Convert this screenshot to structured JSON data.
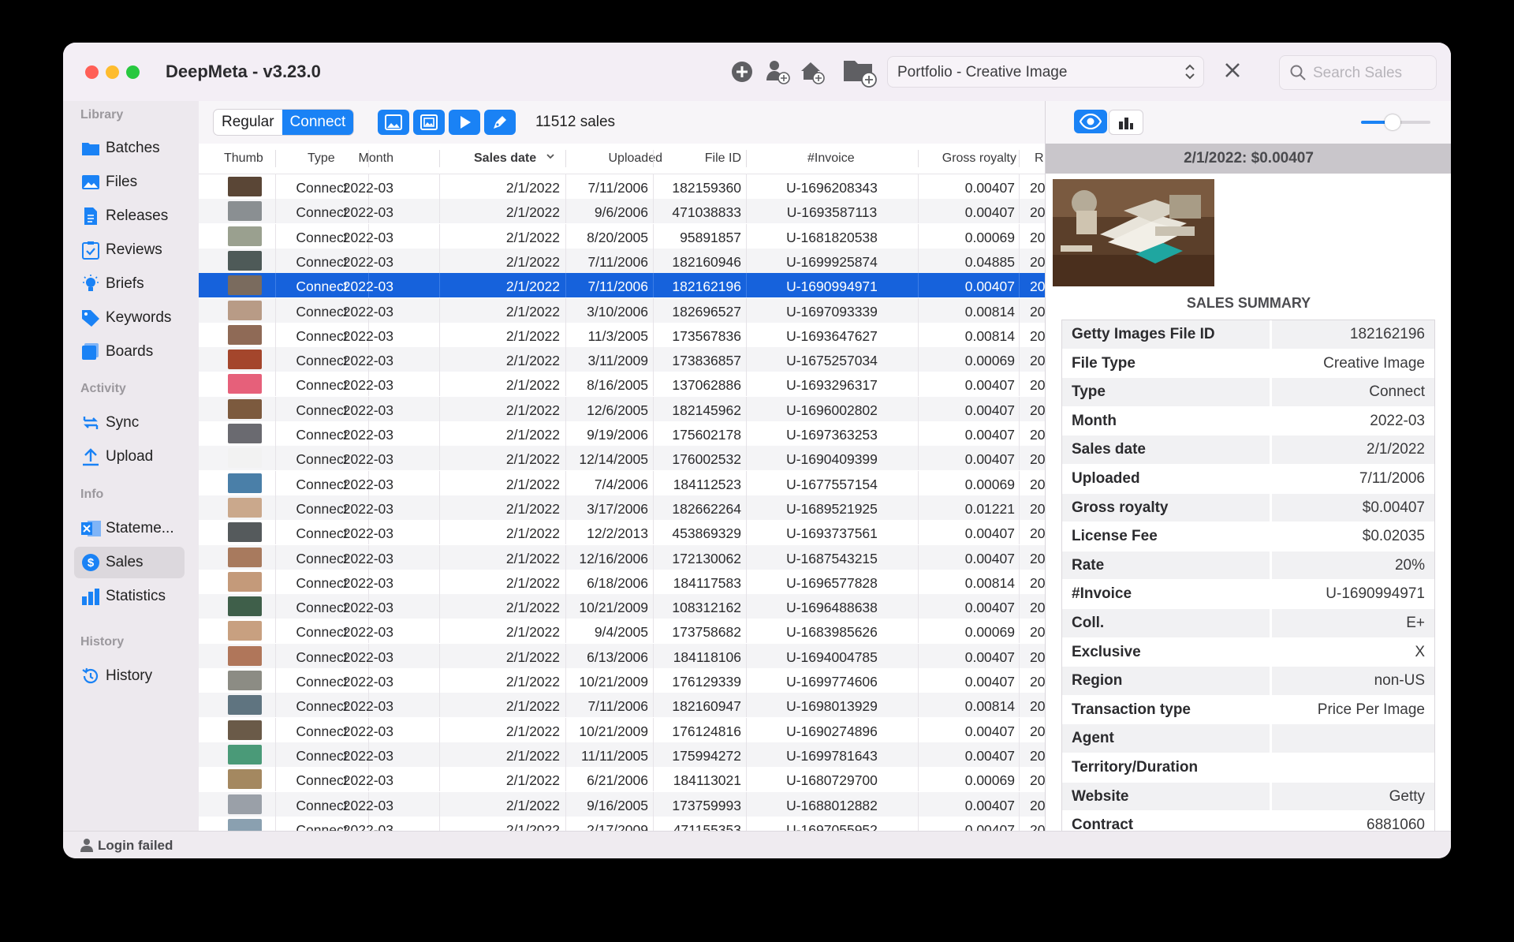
{
  "app": {
    "title": "DeepMeta - v3.23.0"
  },
  "toolbar": {
    "portfolio": "Portfolio - Creative Image",
    "search_placeholder": "Search Sales",
    "mode_regular": "Regular",
    "mode_connect": "Connect",
    "sales_count": "11512 sales"
  },
  "sidebar": {
    "sections": [
      {
        "label": "Library",
        "items": [
          "Batches",
          "Files",
          "Releases",
          "Reviews",
          "Briefs",
          "Keywords",
          "Boards"
        ]
      },
      {
        "label": "Activity",
        "items": [
          "Sync",
          "Upload"
        ]
      },
      {
        "label": "Info",
        "items": [
          "Stateme...",
          "Sales",
          "Statistics"
        ]
      },
      {
        "label": "History",
        "items": [
          "History"
        ]
      }
    ],
    "active": "Sales"
  },
  "table": {
    "columns": [
      "Thumb",
      "Type",
      "Month",
      "Sales date",
      "Uploaded",
      "File ID",
      "#Invoice",
      "Gross royalty",
      "R"
    ],
    "rows": [
      [
        "Connect",
        "2022-03",
        "2/1/2022",
        "7/11/2006",
        "182159360",
        "U-1696208343",
        "0.00407",
        "20"
      ],
      [
        "Connect",
        "2022-03",
        "2/1/2022",
        "9/6/2006",
        "471038833",
        "U-1693587113",
        "0.00407",
        "20"
      ],
      [
        "Connect",
        "2022-03",
        "2/1/2022",
        "8/20/2005",
        "95891857",
        "U-1681820538",
        "0.00069",
        "20"
      ],
      [
        "Connect",
        "2022-03",
        "2/1/2022",
        "7/11/2006",
        "182160946",
        "U-1699925874",
        "0.04885",
        "20"
      ],
      [
        "Connect",
        "2022-03",
        "2/1/2022",
        "7/11/2006",
        "182162196",
        "U-1690994971",
        "0.00407",
        "20"
      ],
      [
        "Connect",
        "2022-03",
        "2/1/2022",
        "3/10/2006",
        "182696527",
        "U-1697093339",
        "0.00814",
        "20"
      ],
      [
        "Connect",
        "2022-03",
        "2/1/2022",
        "11/3/2005",
        "173567836",
        "U-1693647627",
        "0.00814",
        "20"
      ],
      [
        "Connect",
        "2022-03",
        "2/1/2022",
        "3/11/2009",
        "173836857",
        "U-1675257034",
        "0.00069",
        "20"
      ],
      [
        "Connect",
        "2022-03",
        "2/1/2022",
        "8/16/2005",
        "137062886",
        "U-1693296317",
        "0.00407",
        "20"
      ],
      [
        "Connect",
        "2022-03",
        "2/1/2022",
        "12/6/2005",
        "182145962",
        "U-1696002802",
        "0.00407",
        "20"
      ],
      [
        "Connect",
        "2022-03",
        "2/1/2022",
        "9/19/2006",
        "175602178",
        "U-1697363253",
        "0.00407",
        "20"
      ],
      [
        "Connect",
        "2022-03",
        "2/1/2022",
        "12/14/2005",
        "176002532",
        "U-1690409399",
        "0.00407",
        "20"
      ],
      [
        "Connect",
        "2022-03",
        "2/1/2022",
        "7/4/2006",
        "184112523",
        "U-1677557154",
        "0.00069",
        "20"
      ],
      [
        "Connect",
        "2022-03",
        "2/1/2022",
        "3/17/2006",
        "182662264",
        "U-1689521925",
        "0.01221",
        "20"
      ],
      [
        "Connect",
        "2022-03",
        "2/1/2022",
        "12/2/2013",
        "453869329",
        "U-1693737561",
        "0.00407",
        "20"
      ],
      [
        "Connect",
        "2022-03",
        "2/1/2022",
        "12/16/2006",
        "172130062",
        "U-1687543215",
        "0.00407",
        "20"
      ],
      [
        "Connect",
        "2022-03",
        "2/1/2022",
        "6/18/2006",
        "184117583",
        "U-1696577828",
        "0.00814",
        "20"
      ],
      [
        "Connect",
        "2022-03",
        "2/1/2022",
        "10/21/2009",
        "108312162",
        "U-1696488638",
        "0.00407",
        "20"
      ],
      [
        "Connect",
        "2022-03",
        "2/1/2022",
        "9/4/2005",
        "173758682",
        "U-1683985626",
        "0.00069",
        "20"
      ],
      [
        "Connect",
        "2022-03",
        "2/1/2022",
        "6/13/2006",
        "184118106",
        "U-1694004785",
        "0.00407",
        "20"
      ],
      [
        "Connect",
        "2022-03",
        "2/1/2022",
        "10/21/2009",
        "176129339",
        "U-1699774606",
        "0.00407",
        "20"
      ],
      [
        "Connect",
        "2022-03",
        "2/1/2022",
        "7/11/2006",
        "182160947",
        "U-1698013929",
        "0.00814",
        "20"
      ],
      [
        "Connect",
        "2022-03",
        "2/1/2022",
        "10/21/2009",
        "176124816",
        "U-1690274896",
        "0.00407",
        "20"
      ],
      [
        "Connect",
        "2022-03",
        "2/1/2022",
        "11/11/2005",
        "175994272",
        "U-1699781643",
        "0.00407",
        "20"
      ],
      [
        "Connect",
        "2022-03",
        "2/1/2022",
        "6/21/2006",
        "184113021",
        "U-1680729700",
        "0.00069",
        "20"
      ],
      [
        "Connect",
        "2022-03",
        "2/1/2022",
        "9/16/2005",
        "173759993",
        "U-1688012882",
        "0.00407",
        "20"
      ],
      [
        "Connect",
        "2022-03",
        "2/1/2022",
        "2/17/2009",
        "471155353",
        "U-1697055952",
        "0.00407",
        "20"
      ]
    ],
    "thumb_colors": [
      "#5a4636",
      "#8a8f92",
      "#9aa08f",
      "#4e5a58",
      "#7a6b5e",
      "#b89b86",
      "#8f6a56",
      "#a4462c",
      "#e6607a",
      "#7c5a3e",
      "#6a6a70",
      "#f2f2f2",
      "#4a7fa8",
      "#caa88c",
      "#555a5c",
      "#a87a5e",
      "#c49a7a",
      "#3f5f4a",
      "#c8a080",
      "#b0765a",
      "#8c8c84",
      "#5f7480",
      "#6a5a48",
      "#4a9a78",
      "#a48860",
      "#9aa0a8",
      "#8aa0b0"
    ],
    "selected_row_index": 4
  },
  "detail": {
    "header": "2/1/2022: $0.00407",
    "summary_title": "SALES SUMMARY",
    "zoom_level": 0.45,
    "fields": [
      [
        "Getty Images File ID",
        "182162196"
      ],
      [
        "File Type",
        "Creative Image"
      ],
      [
        "Type",
        "Connect"
      ],
      [
        "Month",
        "2022-03"
      ],
      [
        "Sales date",
        "2/1/2022"
      ],
      [
        "Uploaded",
        "7/11/2006"
      ],
      [
        "Gross royalty",
        "$0.00407"
      ],
      [
        "License Fee",
        "$0.02035"
      ],
      [
        "Rate",
        "20%"
      ],
      [
        "#Invoice",
        "U-1690994971"
      ],
      [
        "Coll.",
        "E+"
      ],
      [
        "Exclusive",
        "X"
      ],
      [
        "Region",
        "non-US"
      ],
      [
        "Transaction type",
        "Price Per Image"
      ],
      [
        "Agent",
        ""
      ],
      [
        "Territory/Duration",
        ""
      ],
      [
        "Website",
        "Getty"
      ],
      [
        "Contract",
        "6881060"
      ]
    ]
  },
  "status": {
    "text": "Login failed"
  },
  "colors": {
    "accent": "#1a82f5",
    "selection": "#1662dc"
  }
}
